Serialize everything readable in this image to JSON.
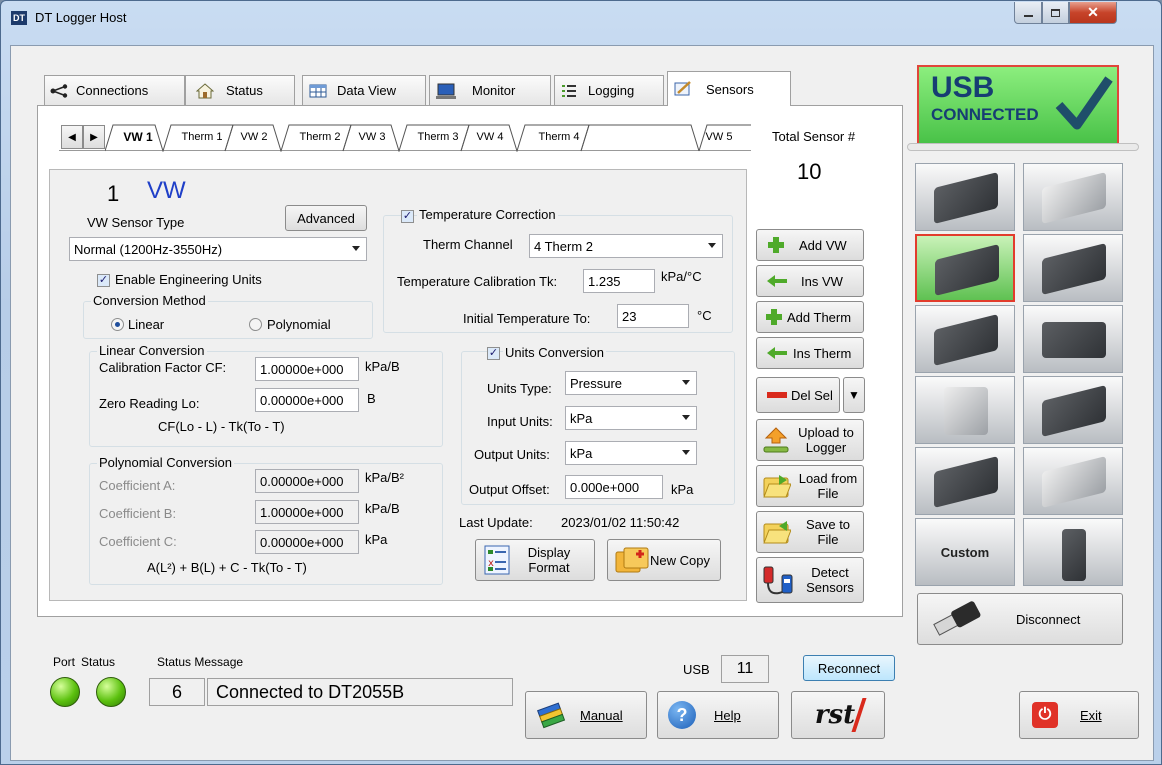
{
  "window": {
    "title": "DT Logger Host",
    "app_icon": "DT"
  },
  "tabs": [
    {
      "label": "Connections",
      "icon": "connections-icon"
    },
    {
      "label": "Status",
      "icon": "home-icon"
    },
    {
      "label": "Data View",
      "icon": "table-icon"
    },
    {
      "label": "Monitor",
      "icon": "monitor-icon"
    },
    {
      "label": "Logging",
      "icon": "logging-icon"
    },
    {
      "label": "Sensors",
      "icon": "sensors-icon"
    }
  ],
  "active_tab": "Sensors",
  "sensor_tabs": [
    "VW 1",
    "Therm 1",
    "VW 2",
    "Therm 2",
    "VW 3",
    "Therm 3",
    "VW 4",
    "Therm 4",
    "VW 5"
  ],
  "total_sensor": {
    "label": "Total Sensor #",
    "value": "10"
  },
  "sensor": {
    "number": "1",
    "type_label": "VW"
  },
  "vw_sensor_type": {
    "label": "VW Sensor Type",
    "value": "Normal (1200Hz-3550Hz)"
  },
  "advanced_label": "Advanced",
  "enable_eng_units": "Enable Engineering Units",
  "conversion_method": {
    "label": "Conversion Method",
    "linear": "Linear",
    "polynomial": "Polynomial",
    "selected": "Linear"
  },
  "linear_conversion": {
    "title": "Linear Conversion",
    "cf_label": "Calibration Factor CF:",
    "cf_value": "1.00000e+000",
    "cf_unit": "kPa/B",
    "lo_label": "Zero Reading Lo:",
    "lo_value": "0.00000e+000",
    "lo_unit": "B",
    "formula": "CF(Lo - L) - Tk(To - T)"
  },
  "polynomial_conversion": {
    "title": "Polynomial Conversion",
    "a_label": "Coefficient A:",
    "a_value": "0.00000e+000",
    "a_unit": "kPa/B²",
    "b_label": "Coefficient B:",
    "b_value": "1.00000e+000",
    "b_unit": "kPa/B",
    "c_label": "Coefficient C:",
    "c_value": "0.00000e+000",
    "c_unit": "kPa",
    "formula": "A(L²) + B(L) + C - Tk(To - T)"
  },
  "temperature_correction": {
    "label": "Temperature Correction",
    "therm_channel_label": "Therm Channel",
    "therm_channel_value": "4 Therm 2",
    "tk_label": "Temperature Calibration Tk:",
    "tk_value": "1.235",
    "tk_unit": "kPa/°C",
    "to_label": "Initial Temperature To:",
    "to_value": "23",
    "to_unit": "°C"
  },
  "units_conversion": {
    "label": "Units Conversion",
    "units_type_label": "Units Type:",
    "units_type_value": "Pressure",
    "input_units_label": "Input Units:",
    "input_units_value": "kPa",
    "output_units_label": "Output Units:",
    "output_units_value": "kPa",
    "output_offset_label": "Output Offset:",
    "output_offset_value": "0.000e+000",
    "output_offset_unit": "kPa"
  },
  "last_update": {
    "label": "Last Update:",
    "value": "2023/01/02 11:50:42"
  },
  "buttons": {
    "display_format": "Display Format",
    "new_copy": "New Copy",
    "add_vw": "Add VW",
    "ins_vw": "Ins VW",
    "add_therm": "Add Therm",
    "ins_therm": "Ins Therm",
    "del_sel": "Del Sel",
    "upload": "Upload to Logger",
    "load": "Load from File",
    "save": "Save to File",
    "detect": "Detect Sensors",
    "disconnect": "Disconnect",
    "custom": "Custom",
    "reconnect": "Reconnect",
    "manual": "Manual",
    "help": "Help",
    "exit": "Exit"
  },
  "usb_banner": {
    "line1": "USB",
    "line2": "CONNECTED"
  },
  "status_bar": {
    "port_label": "Port",
    "status_label": "Status",
    "message_label": "Status Message",
    "code": "6",
    "message": "Connected to DT2055B",
    "usb_label": "USB",
    "usb_value": "11"
  },
  "logo": "rst",
  "colors": {
    "accent_blue": "#1f3fc8",
    "usb_green": "#6fd46a",
    "connected_dark": "#173d73"
  }
}
